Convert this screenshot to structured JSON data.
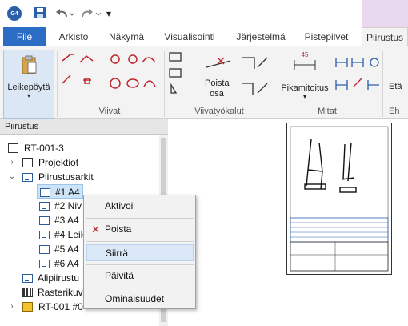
{
  "titlebar": {
    "logo_text": "G4",
    "qmenu_glyph": "▾"
  },
  "tabs": [
    "File",
    "Arkisto",
    "Näkymä",
    "Visualisointi",
    "Järjestelmä",
    "Pistepilvet",
    "Piirustus"
  ],
  "ribbon": {
    "leikepoyta": "Leikepöytä",
    "groups": {
      "viivat": "Viivat",
      "viivatyokalut": "Viivatyökalut",
      "mitat": "Mitat",
      "ehdotus": "Eh"
    },
    "poista_osa": [
      "Poista",
      "osa"
    ],
    "pikamitoitus": "Pikamitoitus",
    "dim_value": "45",
    "eta": "Etä"
  },
  "panel": {
    "title": "Piirustus",
    "tree": [
      {
        "label": "RT-001-3"
      },
      {
        "label": "Projektiot"
      },
      {
        "label": "Piirustusarkit"
      },
      {
        "label": "#1 A4"
      },
      {
        "label": "#2 Niv"
      },
      {
        "label": "#3 A4"
      },
      {
        "label": "#4 Leik"
      },
      {
        "label": "#5 A4"
      },
      {
        "label": "#6 A4"
      },
      {
        "label": "Alipiirustu"
      },
      {
        "label": "Rasterikuv"
      },
      {
        "label": "RT-001 #0"
      }
    ]
  },
  "context_menu": {
    "items": [
      "Aktivoi",
      "Poista",
      "Siirrä",
      "Päivitä",
      "Ominaisuudet"
    ]
  },
  "colors": {
    "file_tab": "#2b6cc4",
    "accent": "#e8d8f0",
    "selection": "#cde3f7",
    "delete_x": "#c0272d"
  }
}
